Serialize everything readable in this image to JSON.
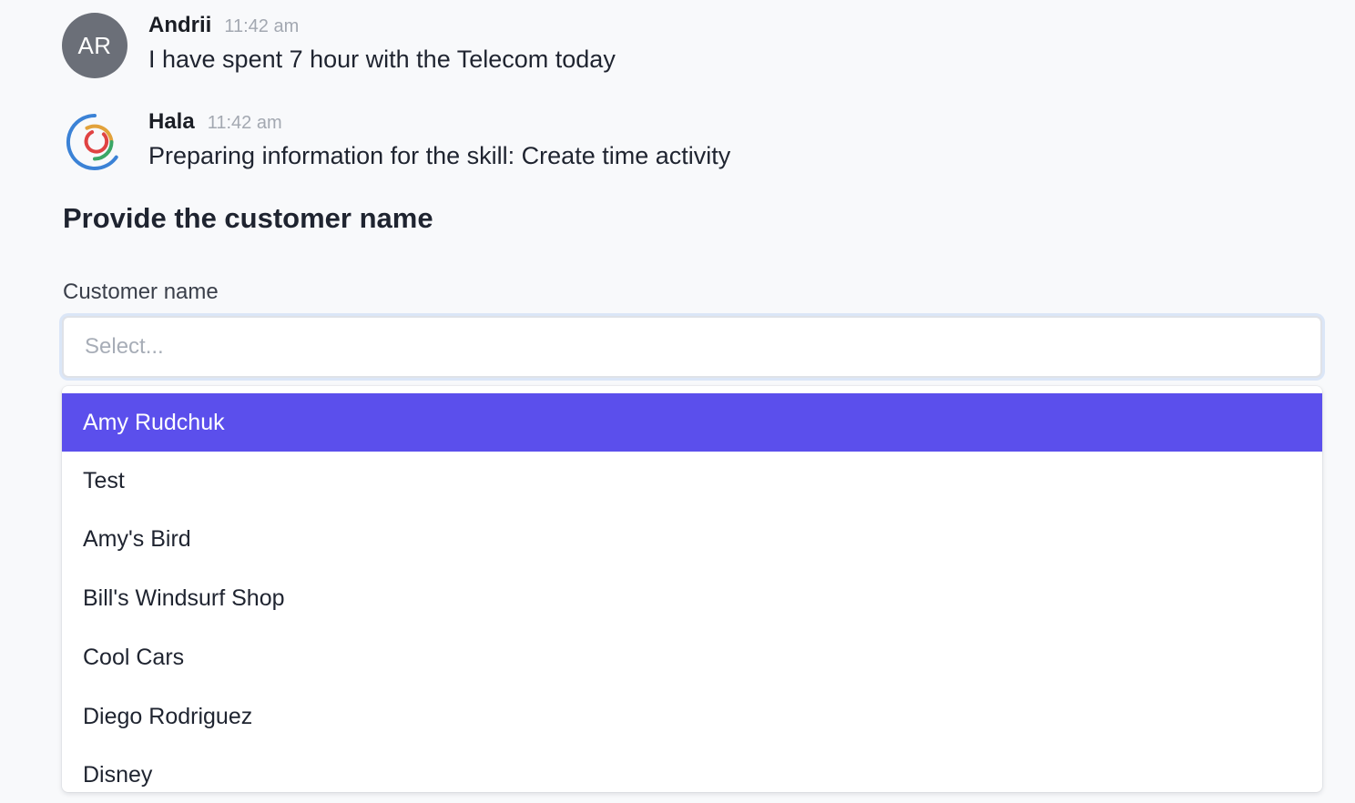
{
  "messages": [
    {
      "avatar": {
        "initials": "AR"
      },
      "name": "Andrii",
      "time": "11:42 am",
      "text": "I have spent 7 hour with the Telecom today"
    },
    {
      "avatar": {
        "icon": "hala-logo-icon"
      },
      "name": "Hala",
      "time": "11:42 am",
      "text": "Preparing information for the skill: Create time activity"
    }
  ],
  "form": {
    "prompt": "Provide the customer name",
    "customer_field": {
      "label": "Customer name",
      "placeholder": "Select...",
      "value": ""
    }
  },
  "dropdown": {
    "highlighted_index": 0,
    "options": [
      "Amy Rudchuk",
      "Test",
      "Amy's Bird",
      "Bill's Windsurf Shop",
      "Cool Cars",
      "Diego Rodriguez",
      "Disney"
    ]
  },
  "colors": {
    "page_background": "#f8f9fb",
    "avatar_gray": "#6b6f78",
    "highlight": "#5b4fec",
    "focus_ring": "#dbe6f7"
  }
}
